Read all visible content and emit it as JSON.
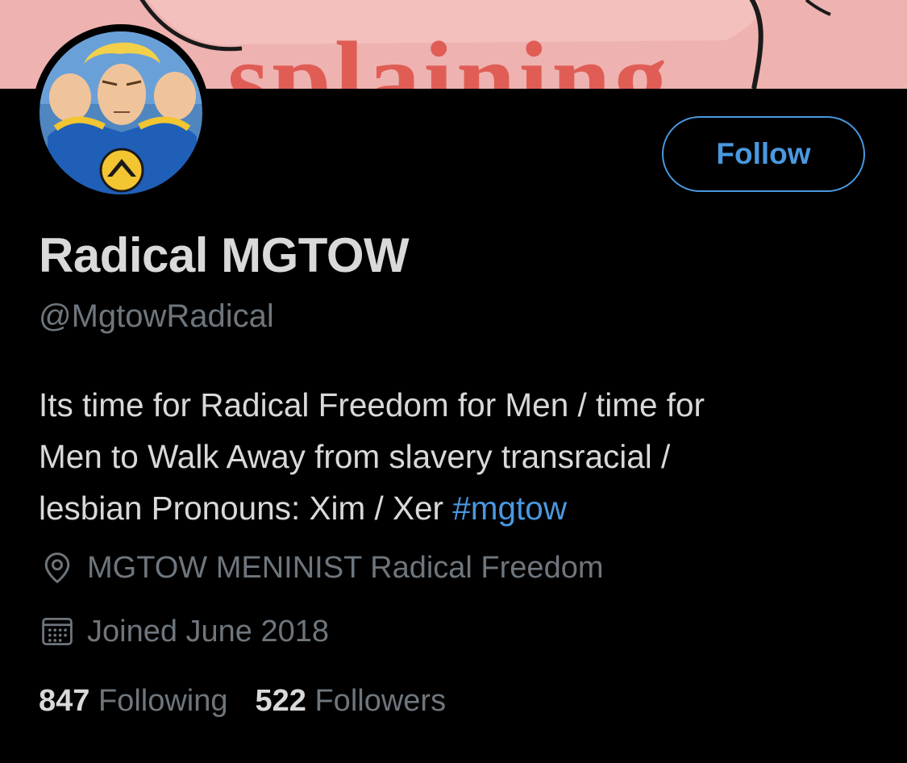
{
  "banner": {
    "text": "splaining",
    "background_color": "#eeb2b0",
    "text_color": "#e05d56"
  },
  "profile": {
    "display_name": "Radical MGTOW",
    "handle": "@MgtowRadical",
    "bio_lines": [
      "Its time for Radical Freedom for Men / time for",
      "Men to Walk Away from slavery transracial /",
      "lesbian Pronouns: Xim / Xer "
    ],
    "hashtag": "#mgtow",
    "location": "MGTOW MENINIST Radical Freedom",
    "joined": "Joined June 2018",
    "location_icon": "location-pin-icon",
    "joined_icon": "calendar-icon"
  },
  "actions": {
    "follow_label": "Follow"
  },
  "stats": {
    "following_count": "847",
    "following_label": "Following",
    "followers_count": "522",
    "followers_label": "Followers"
  },
  "colors": {
    "accent": "#4a98e0",
    "secondary_text": "#6e767d",
    "primary_text": "#d9d9d9",
    "background": "#000000"
  }
}
